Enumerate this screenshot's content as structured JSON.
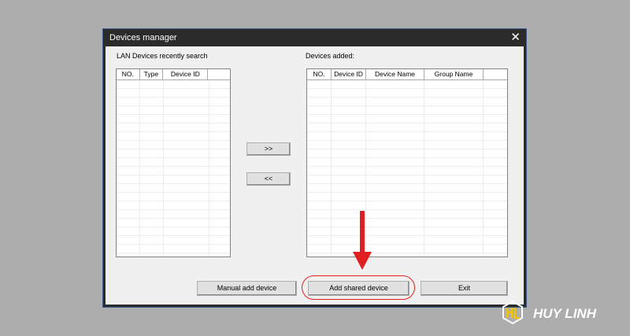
{
  "window": {
    "title": "Devices manager",
    "close_icon": "close-icon"
  },
  "left": {
    "label": "LAN Devices recently search",
    "columns": [
      "NO.",
      "Type",
      "Device ID",
      ""
    ]
  },
  "right": {
    "label": "Devices added:",
    "columns": [
      "NO.",
      "Device ID",
      "Device Name",
      "Group Name",
      ""
    ]
  },
  "buttons": {
    "add": ">>",
    "remove": "<<",
    "manual": "Manual add device",
    "shared": "Add shared device",
    "exit": "Exit"
  },
  "annotation": {
    "color": "#e02020"
  },
  "brand": {
    "name": "HUY LINH"
  }
}
